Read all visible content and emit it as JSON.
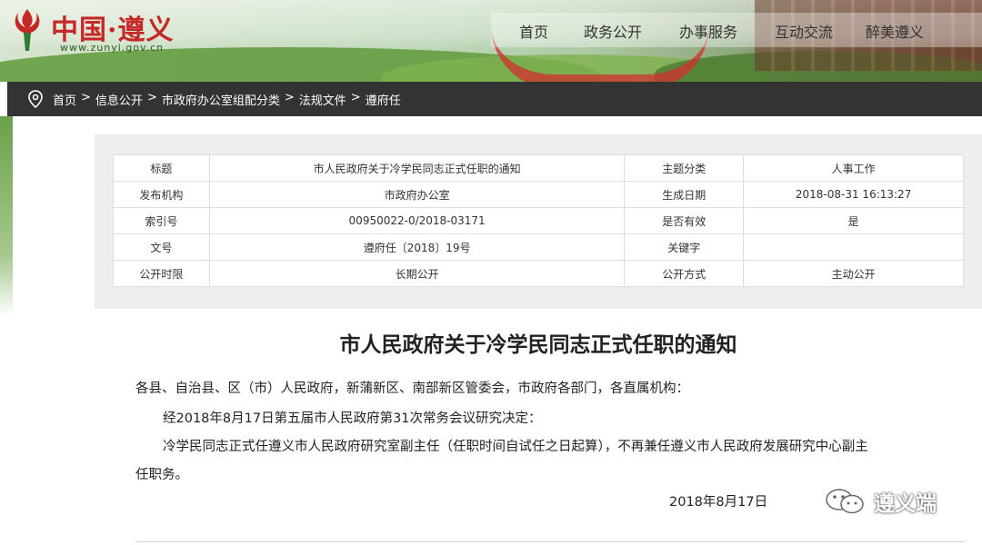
{
  "header": {
    "logo_title": "中国·遵义",
    "logo_url": "www.zunyi.gov.cn",
    "nav": [
      "首页",
      "政务公开",
      "办事服务",
      "互动交流",
      "醉美遵义"
    ]
  },
  "breadcrumb": {
    "items": [
      "首页",
      "信息公开",
      "市政府办公室组配分类",
      "法规文件",
      "遵府任"
    ],
    "separator": ">"
  },
  "meta": {
    "rows": [
      {
        "k1": "标题",
        "v1": "市人民政府关于冷学民同志正式任职的通知",
        "k2": "主题分类",
        "v2": "人事工作"
      },
      {
        "k1": "发布机构",
        "v1": "市政府办公室",
        "k2": "生成日期",
        "v2": "2018-08-31 16:13:27"
      },
      {
        "k1": "索引号",
        "v1": "00950022-0/2018-03171",
        "k2": "是否有效",
        "v2": "是"
      },
      {
        "k1": "文号",
        "v1": "遵府任〔2018〕19号",
        "k2": "关键字",
        "v2": ""
      },
      {
        "k1": "公开时限",
        "v1": "长期公开",
        "k2": "公开方式",
        "v2": "主动公开"
      }
    ]
  },
  "document": {
    "title": "市人民政府关于冷学民同志正式任职的通知",
    "salutation": "各县、自治县、区（市）人民政府，新蒲新区、南部新区管委会，市政府各部门，各直属机构：",
    "para1": "经2018年8月17日第五届市人民政府第31次常务会议研究决定：",
    "para2_line1": "冷学民同志正式任遵义市人民政府研究室副主任（任职时间自试任之日起算），不再兼任遵义市人民政府发展研究中心副主",
    "para2_line2": "任职务。",
    "date": "2018年8月17日"
  },
  "watermark": {
    "text": "遵义端",
    "icon": "wechat-icon"
  },
  "colors": {
    "breadcrumb_bg": "#333333",
    "logo_red": "#c62828",
    "meta_bg": "#eeeeee"
  }
}
